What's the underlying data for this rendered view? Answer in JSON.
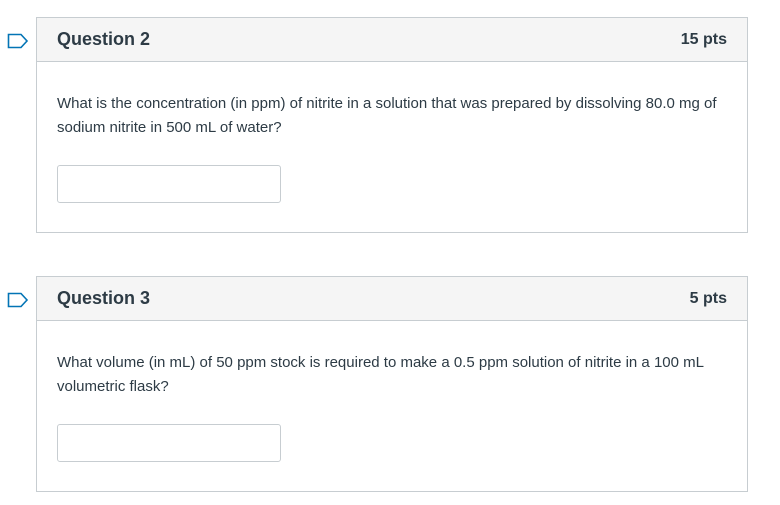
{
  "questions": [
    {
      "title": "Question 2",
      "points": "15 pts",
      "text": "What is the concentration (in ppm) of nitrite in a solution that was prepared by dissolving 80.0 mg of sodium nitrite in 500 mL of water?",
      "answer_value": ""
    },
    {
      "title": "Question 3",
      "points": "5 pts",
      "text": "What volume (in mL) of 50 ppm stock is required to make a 0.5 ppm solution of nitrite in a 100 mL volumetric flask?",
      "answer_value": ""
    }
  ],
  "flag_icon": "flag-outline-icon",
  "colors": {
    "flag": "#0374b5",
    "header_bg": "#f5f5f5",
    "border": "#c7cdd1",
    "text": "#2d3b45"
  }
}
